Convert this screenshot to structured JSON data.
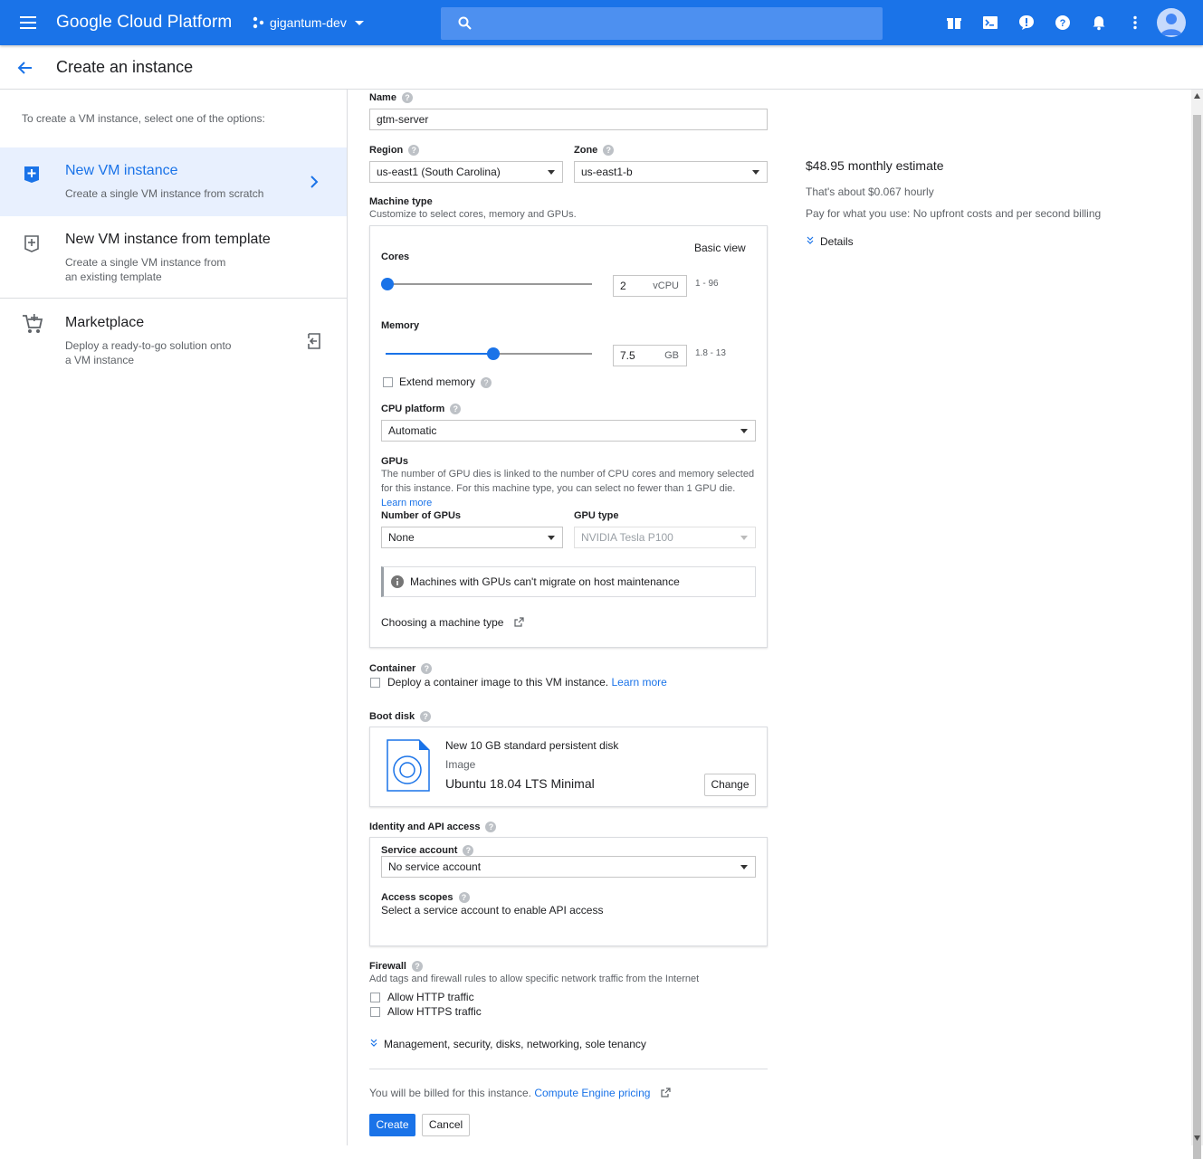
{
  "topbar": {
    "brand": "Google Cloud Platform",
    "project": "gigantum-dev",
    "color": "#1a73e8"
  },
  "header": {
    "title": "Create an instance"
  },
  "sidebar": {
    "intro": "To create a VM instance, select one of the options:",
    "options": [
      {
        "title": "New VM instance",
        "desc": "Create a single VM instance from scratch",
        "selected": true
      },
      {
        "title": "New VM instance from template",
        "desc1": "Create a single VM instance from",
        "desc2": "an existing template"
      },
      {
        "title": "Marketplace",
        "desc1": "Deploy a ready-to-go solution onto",
        "desc2": "a VM instance"
      }
    ]
  },
  "form": {
    "name": {
      "label": "Name",
      "value": "gtm-server"
    },
    "region": {
      "label": "Region",
      "value": "us-east1 (South Carolina)"
    },
    "zone": {
      "label": "Zone",
      "value": "us-east1-b"
    },
    "machine_type": {
      "label": "Machine type",
      "sub": "Customize to select cores, memory and GPUs.",
      "basic_view": "Basic view",
      "cores": {
        "label": "Cores",
        "value": "2",
        "unit": "vCPU",
        "range": "1 - 96",
        "level": 0.01
      },
      "memory": {
        "label": "Memory",
        "value": "7.5",
        "unit": "GB",
        "range": "1.8 - 13",
        "level": 0.52
      },
      "extend_memory": "Extend memory",
      "cpu_platform": {
        "label": "CPU platform",
        "value": "Automatic"
      },
      "gpus": {
        "label": "GPUs",
        "desc1": "The number of GPU dies is linked to the number of CPU cores and memory selected",
        "desc2": "for this instance. For this machine type, you can select no fewer than 1 GPU die.",
        "learn_more": "Learn more",
        "number_label": "Number of GPUs",
        "number_value": "None",
        "type_label": "GPU type",
        "type_value": "NVIDIA Tesla P100",
        "notice": "Machines with GPUs can't migrate on host maintenance"
      },
      "choosing_link": "Choosing a machine type"
    },
    "container": {
      "label": "Container",
      "text": "Deploy a container image to this VM instance.",
      "link": "Learn more"
    },
    "boot_disk": {
      "label": "Boot disk",
      "title": "New 10 GB standard persistent disk",
      "image_label": "Image",
      "image": "Ubuntu 18.04 LTS Minimal",
      "change": "Change"
    },
    "identity": {
      "label": "Identity and API access",
      "service_account_label": "Service account",
      "service_account_value": "No service account",
      "scopes_label": "Access scopes",
      "scopes_text": "Select a service account to enable API access"
    },
    "firewall": {
      "label": "Firewall",
      "sub": "Add tags and firewall rules to allow specific network traffic from the Internet",
      "http": "Allow HTTP traffic",
      "https": "Allow HTTPS traffic"
    },
    "management_link": "Management, security, disks, networking, sole tenancy",
    "billing_text": "You will be billed for this instance.",
    "pricing_link": "Compute Engine pricing",
    "create": "Create",
    "cancel": "Cancel"
  },
  "estimate": {
    "monthly": "$48.95 monthly estimate",
    "hourly": "That's about $0.067 hourly",
    "billing": "Pay for what you use: No upfront costs and per second billing",
    "details": "Details"
  }
}
